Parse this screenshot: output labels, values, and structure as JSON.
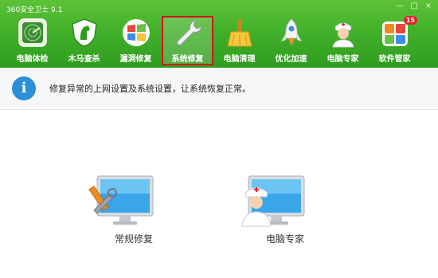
{
  "window": {
    "title": "360安全卫士 9.1",
    "buttons": [
      "—",
      "□",
      "×"
    ]
  },
  "toolbar": {
    "items": [
      {
        "label": "电脑体检",
        "icon": "radar-icon"
      },
      {
        "label": "木马查杀",
        "icon": "horse-shield-icon"
      },
      {
        "label": "漏洞修复",
        "icon": "windows-patch-icon"
      },
      {
        "label": "系统修复",
        "icon": "wrench-icon",
        "selected": true
      },
      {
        "label": "电脑清理",
        "icon": "broom-icon"
      },
      {
        "label": "优化加速",
        "icon": "rocket-icon"
      },
      {
        "label": "电脑专家",
        "icon": "doctor-icon"
      },
      {
        "label": "软件管家",
        "icon": "app-grid-icon",
        "badge": "15"
      }
    ]
  },
  "info": {
    "text": "修复异常的上网设置及系统设置，让系统恢复正常。"
  },
  "options": [
    {
      "label": "常规修复",
      "icon": "repair-tools-monitor-icon"
    },
    {
      "label": "电脑专家",
      "icon": "doctor-monitor-icon"
    }
  ],
  "colors": {
    "header_green": "#43b12b",
    "selection_border": "#d01818",
    "info_blue": "#2a8fd6"
  }
}
